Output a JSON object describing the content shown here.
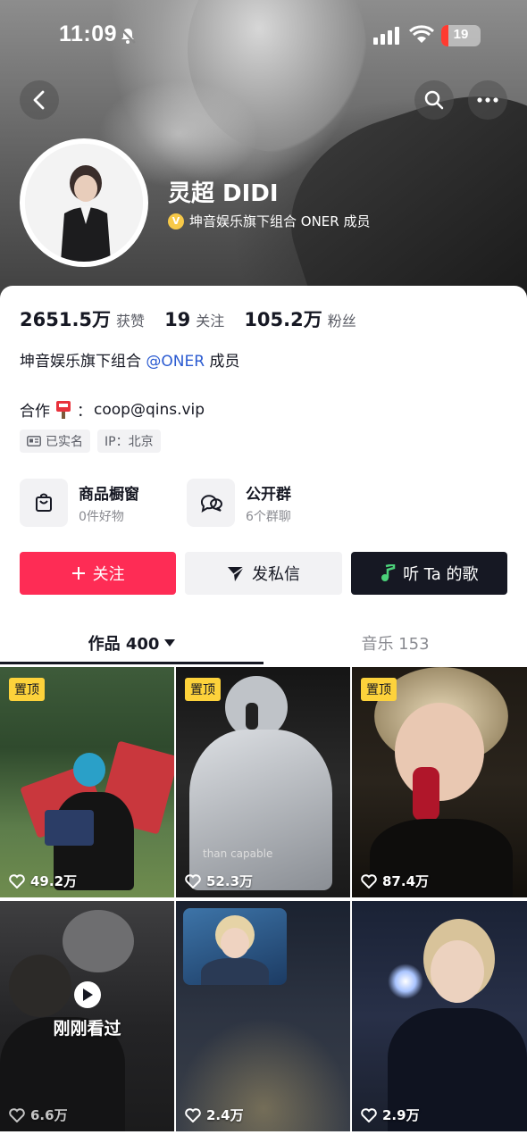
{
  "status_bar": {
    "time": "11:09",
    "battery": "19"
  },
  "profile": {
    "name": "灵超 DIDI",
    "verification": "坤音娱乐旗下组合 ONER 成员"
  },
  "stats": [
    {
      "value": "2651.5万",
      "label": "获赞"
    },
    {
      "value": "19",
      "label": "关注"
    },
    {
      "value": "105.2万",
      "label": "粉丝"
    }
  ],
  "bio": {
    "prefix": "坤音娱乐旗下组合 ",
    "mention": "@ONER",
    "suffix": " 成员"
  },
  "contact": {
    "label": "合作",
    "sep": "：",
    "email": "coop@qins.vip"
  },
  "tags": {
    "realname": "已实名",
    "ip": "IP：北京"
  },
  "shortcuts": [
    {
      "title": "商品橱窗",
      "subtitle": "0件好物",
      "icon": "shopping-bag-icon"
    },
    {
      "title": "公开群",
      "subtitle": "6个群聊",
      "icon": "chat-bubbles-icon"
    }
  ],
  "actions": {
    "follow": "关注",
    "message": "发私信",
    "song": "听 Ta 的歌"
  },
  "tabs": {
    "works": "作品 400",
    "music": "音乐 153"
  },
  "videos": [
    {
      "pinned": "置顶",
      "likes": "49.2万"
    },
    {
      "pinned": "置顶",
      "likes": "52.3万",
      "caption": "than capable"
    },
    {
      "pinned": "置顶",
      "likes": "87.4万"
    },
    {
      "likes": "6.6万",
      "recent": "刚刚看过"
    },
    {
      "likes": "2.4万"
    },
    {
      "likes": "2.9万"
    }
  ],
  "colors": {
    "accent": "#fe2c55",
    "dark_button": "#161823",
    "pin_badge": "#fdd23b",
    "mention": "#2b5bd1"
  }
}
